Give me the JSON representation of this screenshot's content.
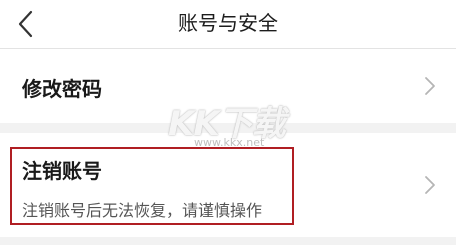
{
  "header": {
    "title": "账号与安全",
    "back_icon": "chevron-left-icon"
  },
  "rows": [
    {
      "label": "修改密码",
      "icon": "chevron-right-icon"
    },
    {
      "label": "注销账号",
      "subtitle": "注销账号后无法恢复，请谨慎操作",
      "icon": "chevron-right-icon"
    }
  ],
  "watermark": {
    "logo_text": "KK下载",
    "url": "www.kkx.net"
  },
  "colors": {
    "background": "#f2f2f2",
    "card": "#ffffff",
    "highlight_border": "#b01e23",
    "chevron": "#b5b5b5"
  }
}
